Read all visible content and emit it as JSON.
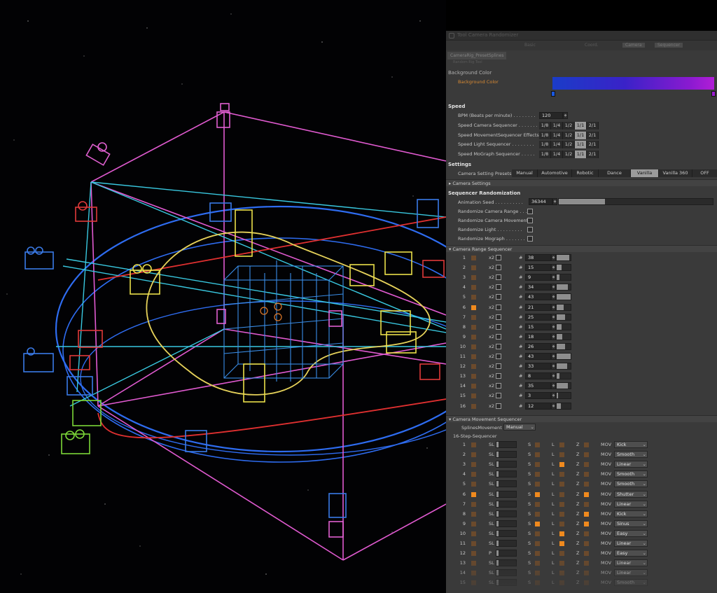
{
  "panel": {
    "title_text": "Tool Camera Randomizer",
    "menu_items": [
      "Basic",
      "Coord.",
      "Camera",
      "Sequencer"
    ],
    "object_tab": "CameraRig_PresetSplines",
    "object_sub": "Random Rig Tool",
    "background_color": {
      "section": "Background Color",
      "label": "Background Color"
    },
    "speed": {
      "section": "Speed",
      "bpm_label": "BPM (Beats per minute) . . . . . . . .",
      "bpm_value": "120",
      "options": [
        "1/8",
        "1/4",
        "1/2",
        "1/1",
        "2/1"
      ],
      "rows": [
        {
          "label": "Speed Camera Sequencer . . . . . . .",
          "selected": "1/1"
        },
        {
          "label": "Speed MovementSequencer Effects",
          "selected": "1/1"
        },
        {
          "label": "Speed Light Sequencer . . . . . . . .",
          "selected": "1/1"
        },
        {
          "label": "Speed MoGraph Sequencer . . . . .",
          "selected": "1/1"
        }
      ]
    },
    "settings": {
      "section": "Settings",
      "presets_label": "Camera Setting Presets",
      "presets": [
        "Manual",
        "Automotive",
        "Robotic",
        "Dance",
        "Vanilla",
        "Vanilla 360",
        "OFF"
      ],
      "active_preset": "Vanilla",
      "camera_settings": "Camera Settings"
    },
    "randomization": {
      "section": "Sequencer Randomization",
      "seed_label": "Animation Seed . . . . . . . . . .",
      "seed_value": "36344",
      "seed_fill": 0.3,
      "checks": [
        "Randomize Camera Range . . .",
        "Randomize Camera Movement",
        "Randomize Light . . . . . . . . .",
        "Randomize Mograph . . . . . . ."
      ]
    },
    "range_sequencer": {
      "title": "Camera Range Sequencer",
      "x2_label": "x2",
      "hash": "#",
      "rows": [
        {
          "n": "1",
          "on": false,
          "v": "38"
        },
        {
          "n": "2",
          "on": false,
          "v": "15"
        },
        {
          "n": "3",
          "on": false,
          "v": "9"
        },
        {
          "n": "4",
          "on": false,
          "v": "34"
        },
        {
          "n": "5",
          "on": false,
          "v": "43"
        },
        {
          "n": "6",
          "on": true,
          "v": "21"
        },
        {
          "n": "7",
          "on": false,
          "v": "25"
        },
        {
          "n": "8",
          "on": false,
          "v": "15"
        },
        {
          "n": "9",
          "on": false,
          "v": "18"
        },
        {
          "n": "10",
          "on": false,
          "v": "26"
        },
        {
          "n": "11",
          "on": false,
          "v": "43"
        },
        {
          "n": "12",
          "on": false,
          "v": "33"
        },
        {
          "n": "13",
          "on": false,
          "v": "8"
        },
        {
          "n": "14",
          "on": false,
          "v": "35"
        },
        {
          "n": "15",
          "on": false,
          "v": "3"
        },
        {
          "n": "16",
          "on": false,
          "v": "12"
        }
      ]
    },
    "movement_sequencer": {
      "title": "Camera Movement Sequencer",
      "splines_label": "SplinesMovement",
      "splines_value": "Manual",
      "step_label": "16-Step-Sequencer",
      "s_label": "S",
      "l_label": "L",
      "z_label": "Z",
      "mov_label": "MOV",
      "rows": [
        {
          "n": "1",
          "on": false,
          "sl": "SL",
          "s": false,
          "l": false,
          "z": false,
          "mov": "Kick"
        },
        {
          "n": "2",
          "on": false,
          "sl": "SL",
          "s": false,
          "l": false,
          "z": false,
          "mov": "Smooth"
        },
        {
          "n": "3",
          "on": false,
          "sl": "SL",
          "s": false,
          "l": true,
          "z": false,
          "mov": "Linear"
        },
        {
          "n": "4",
          "on": false,
          "sl": "SL",
          "s": false,
          "l": false,
          "z": false,
          "mov": "Smooth"
        },
        {
          "n": "5",
          "on": false,
          "sl": "SL",
          "s": false,
          "l": false,
          "z": false,
          "mov": "Smooth"
        },
        {
          "n": "6",
          "on": true,
          "sl": "SL",
          "s": true,
          "l": false,
          "z": true,
          "mov": "Shutter"
        },
        {
          "n": "7",
          "on": false,
          "sl": "SL",
          "s": false,
          "l": false,
          "z": false,
          "mov": "Linear"
        },
        {
          "n": "8",
          "on": false,
          "sl": "SL",
          "s": false,
          "l": false,
          "z": true,
          "mov": "Kick"
        },
        {
          "n": "9",
          "on": false,
          "sl": "SL",
          "s": true,
          "l": false,
          "z": true,
          "mov": "Sinus"
        },
        {
          "n": "10",
          "on": false,
          "sl": "SL",
          "s": false,
          "l": true,
          "z": false,
          "mov": "Easy"
        },
        {
          "n": "11",
          "on": false,
          "sl": "SL",
          "s": false,
          "l": true,
          "z": false,
          "mov": "Linear"
        },
        {
          "n": "12",
          "on": false,
          "sl": "P",
          "s": false,
          "l": false,
          "z": false,
          "mov": "Easy"
        },
        {
          "n": "13",
          "on": false,
          "sl": "SL",
          "s": false,
          "l": false,
          "z": false,
          "mov": "Linear"
        },
        {
          "n": "14",
          "on": false,
          "sl": "SL",
          "s": false,
          "l": false,
          "z": false,
          "mov": "Linear"
        },
        {
          "n": "15",
          "on": false,
          "sl": "SL",
          "s": false,
          "l": false,
          "z": false,
          "mov": "Smooth"
        }
      ]
    }
  }
}
